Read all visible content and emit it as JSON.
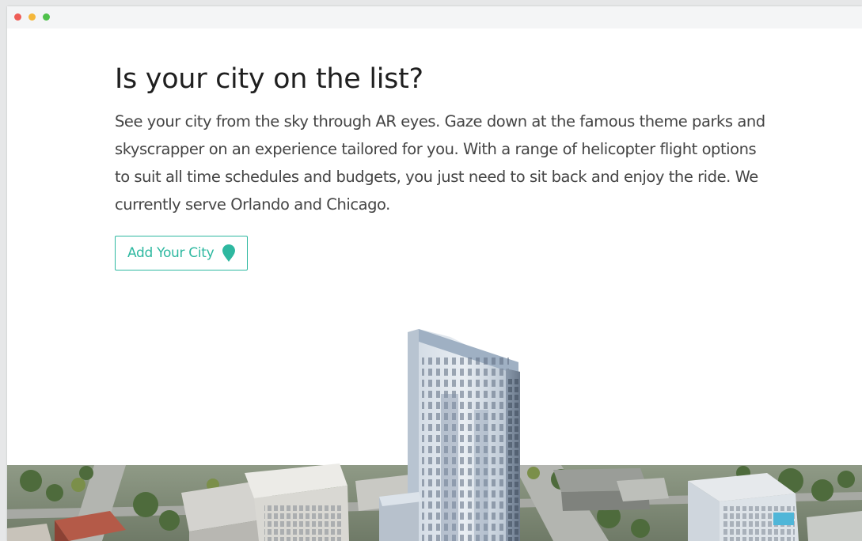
{
  "window": {
    "controls": [
      "close",
      "minimize",
      "maximize"
    ],
    "colors": {
      "close": "#ee5d57",
      "minimize": "#f4b73a",
      "maximize": "#4fc14b"
    }
  },
  "main": {
    "heading": "Is your city on the list?",
    "description": "See your city from the sky through AR eyes. Gaze down at the famous theme parks and skyscrapper on an experience tailored for you. With a range of helicopter flight options to suit all time schedules and budgets, you just need to sit back and enjoy the ride. We currently serve Orlando and Chicago.",
    "add_city_button": {
      "label": "Add Your City",
      "icon": "map-pin-icon",
      "color": "#2eb8a0"
    }
  },
  "hero_image": {
    "subject": "aerial-city-skyscraper"
  }
}
